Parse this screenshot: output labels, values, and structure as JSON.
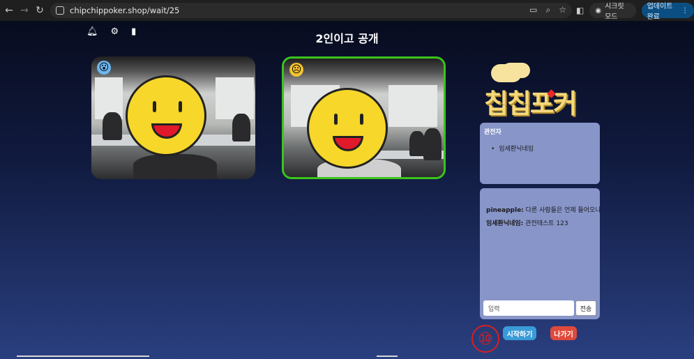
{
  "browser": {
    "url": "chipchippoker.shop/wait/25",
    "incognito_label": "시크릿 모드",
    "update_label": "업데이트 완료"
  },
  "room": {
    "title": "2인이고 공개"
  },
  "logo": {
    "text": "칩칩포커"
  },
  "spectators": {
    "heading": "관전자",
    "items": [
      "임세환닉네임"
    ]
  },
  "chat": {
    "messages": [
      {
        "user": "pineapple:",
        "text": "다른 사람들은 언제 들어오나"
      },
      {
        "user": "임세환닉네임:",
        "text": "관전테스트 123"
      }
    ],
    "input_placeholder": "입력",
    "send_label": "전송"
  },
  "actions": {
    "start_label": "시작하기",
    "exit_label": "나가기"
  },
  "annotation": "⑩",
  "colors": {
    "accent_blue": "#3a9bd8",
    "exit_red": "#e04a3c",
    "panel": "#8895c9",
    "active_border": "#39c51c"
  }
}
